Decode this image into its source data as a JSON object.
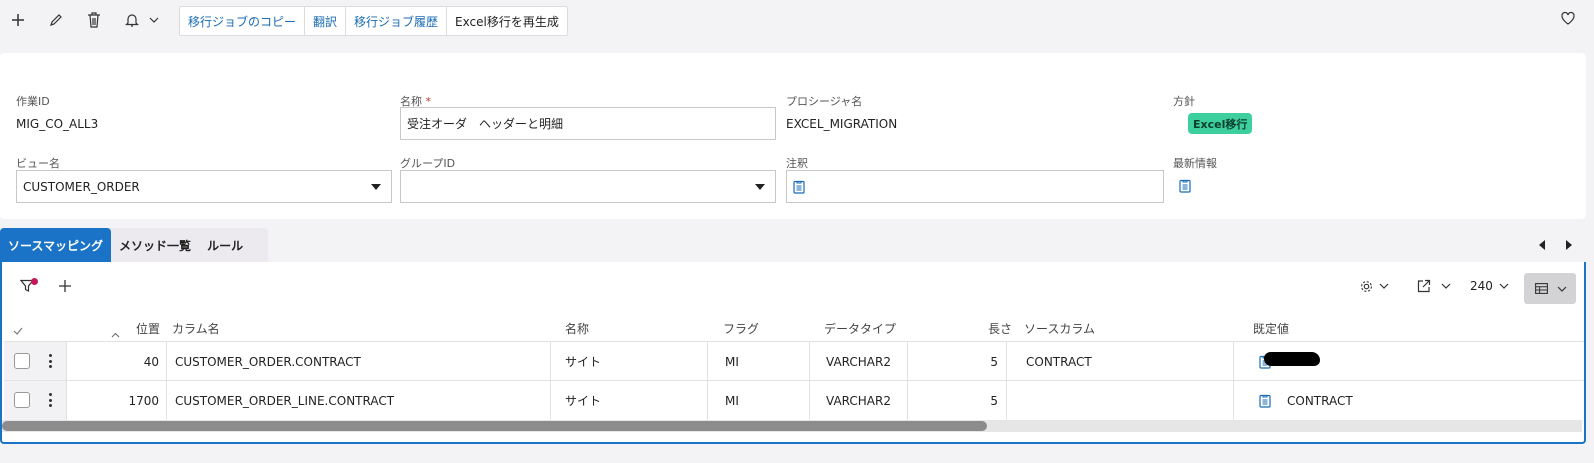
{
  "toolbar": {
    "icons": [
      "plus-icon",
      "pencil-icon",
      "trash-icon",
      "bell-icon",
      "chevron-down-icon"
    ],
    "buttons": [
      "移行ジョブのコピー",
      "翻訳",
      "移行ジョブ履歴",
      "Excel移行を再生成"
    ]
  },
  "form": {
    "job_id_label": "作業ID",
    "job_id_value": "MIG_CO_ALL3",
    "name_label": "名称",
    "required_mark": "*",
    "name_value": "受注オーダ　ヘッダーと明細",
    "procedure_label": "プロシージャ名",
    "procedure_value": "EXCEL_MIGRATION",
    "policy_label": "方針",
    "policy_badge": "Excel移行",
    "view_label": "ビュー名",
    "view_value": "CUSTOMER_ORDER",
    "group_label": "グループID",
    "group_value": "",
    "note_label": "注釈",
    "latest_label": "最新情報"
  },
  "tabs": [
    {
      "label": "ソースマッピング",
      "active": true
    },
    {
      "label": "メソッド一覧",
      "active": false
    },
    {
      "label": "ルール",
      "active": false
    }
  ],
  "grid": {
    "page_size": "240",
    "columns": {
      "position": "位置",
      "column_name": "カラム名",
      "name": "名称",
      "flag": "フラグ",
      "data_type": "データタイプ",
      "length": "長さ",
      "source_column": "ソースカラム",
      "default_value": "既定値"
    },
    "rows": [
      {
        "position": "40",
        "column_name": "CUSTOMER_ORDER.CONTRACT",
        "name": "サイト",
        "flag": "MI",
        "data_type": "VARCHAR2",
        "length": "5",
        "source_column": "CONTRACT",
        "default_value": ""
      },
      {
        "position": "1700",
        "column_name": "CUSTOMER_ORDER_LINE.CONTRACT",
        "name": "サイト",
        "flag": "MI",
        "data_type": "VARCHAR2",
        "length": "5",
        "source_column": "",
        "default_value": "CONTRACT"
      }
    ]
  },
  "colors": {
    "accent": "#1a73c7",
    "link": "#1a6bb3",
    "badge": "#3ecf9e",
    "filter_dot": "#c2185b"
  }
}
